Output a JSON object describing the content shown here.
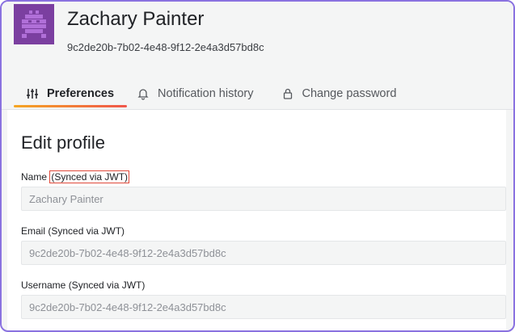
{
  "user": {
    "name": "Zachary Painter",
    "id": "9c2de20b-7b02-4e48-9f12-2e4a3d57bd8c"
  },
  "tabs": [
    {
      "label": "Preferences",
      "icon": "sliders-icon",
      "active": true
    },
    {
      "label": "Notification history",
      "icon": "bell-icon",
      "active": false
    },
    {
      "label": "Change password",
      "icon": "lock-icon",
      "active": false
    }
  ],
  "form": {
    "title": "Edit profile",
    "fields": [
      {
        "label": "Name",
        "label_suffix": "(Synced via JWT)",
        "value": "Zachary Painter"
      },
      {
        "label": "Email (Synced via JWT)",
        "value": "9c2de20b-7b02-4e48-9f12-2e4a3d57bd8c"
      },
      {
        "label": "Username (Synced via JWT)",
        "value": "9c2de20b-7b02-4e48-9f12-2e4a3d57bd8c"
      }
    ]
  },
  "colors": {
    "avatar_bg": "#7b3fa0",
    "frame_border": "#8a72e0",
    "tab_underline_start": "#f5a623",
    "tab_underline_end": "#f0564b",
    "highlight_box": "#e0493a"
  }
}
